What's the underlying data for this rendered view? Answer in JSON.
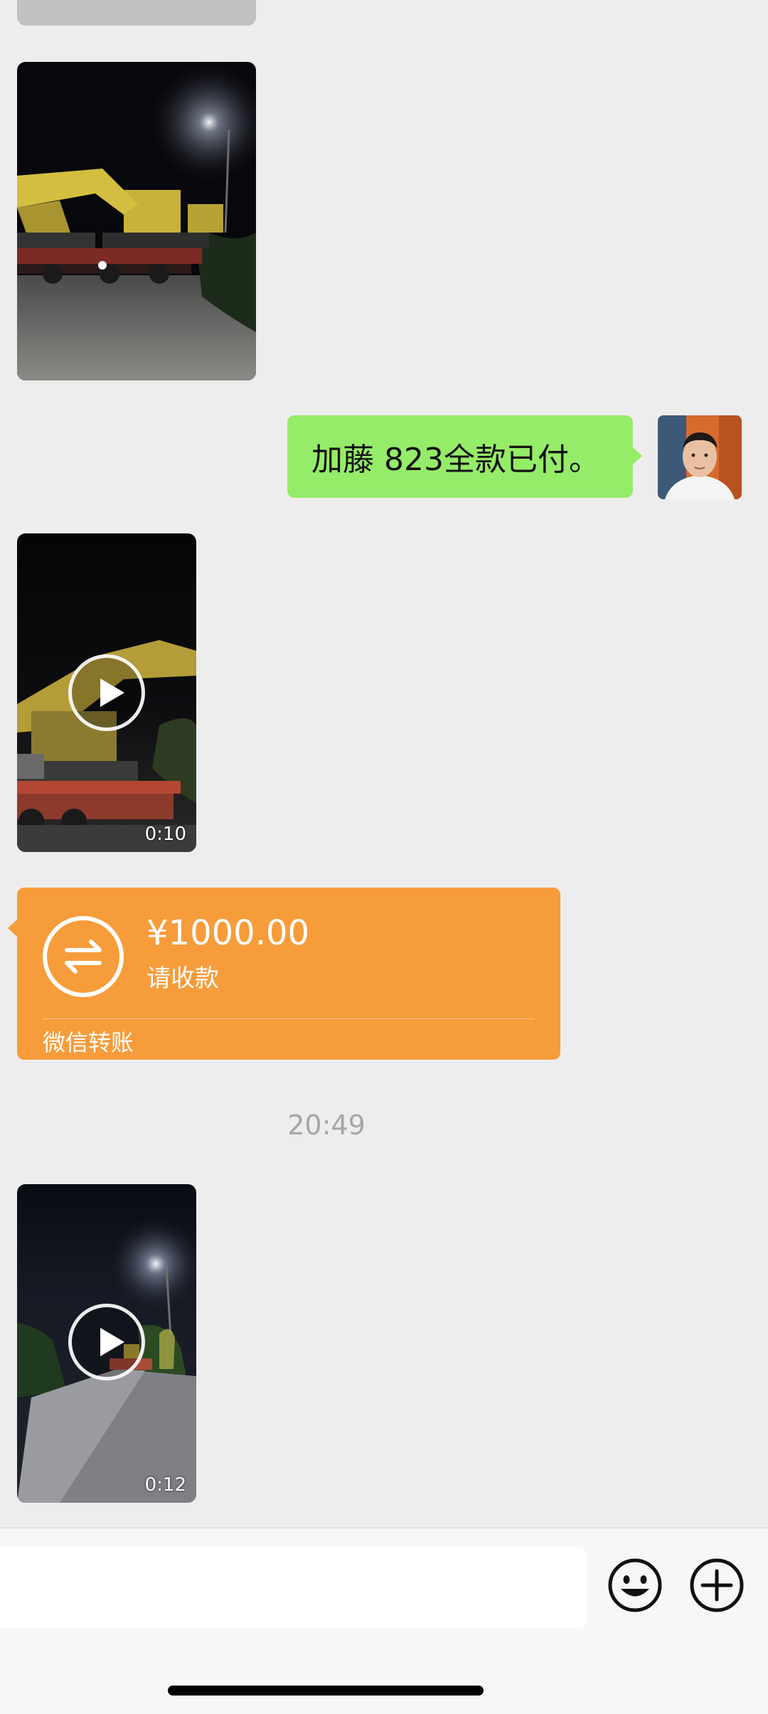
{
  "messages": {
    "outgoing_text": "加藤 823全款已付。",
    "video_1": {
      "duration": "0:10"
    },
    "video_2": {
      "duration": "0:12"
    }
  },
  "transfer": {
    "amount": "¥1000.00",
    "status": "请收款",
    "footer": "微信转账",
    "color": "#f79c3a"
  },
  "timestamp": "20:49",
  "input_bar": {
    "placeholder": "",
    "emoji_icon": "smiley-icon",
    "more_icon": "plus-circle-icon"
  },
  "colors": {
    "background": "#ededed",
    "outgoing_bubble": "#95ec69",
    "timestamp_text": "#a6a6a6"
  }
}
